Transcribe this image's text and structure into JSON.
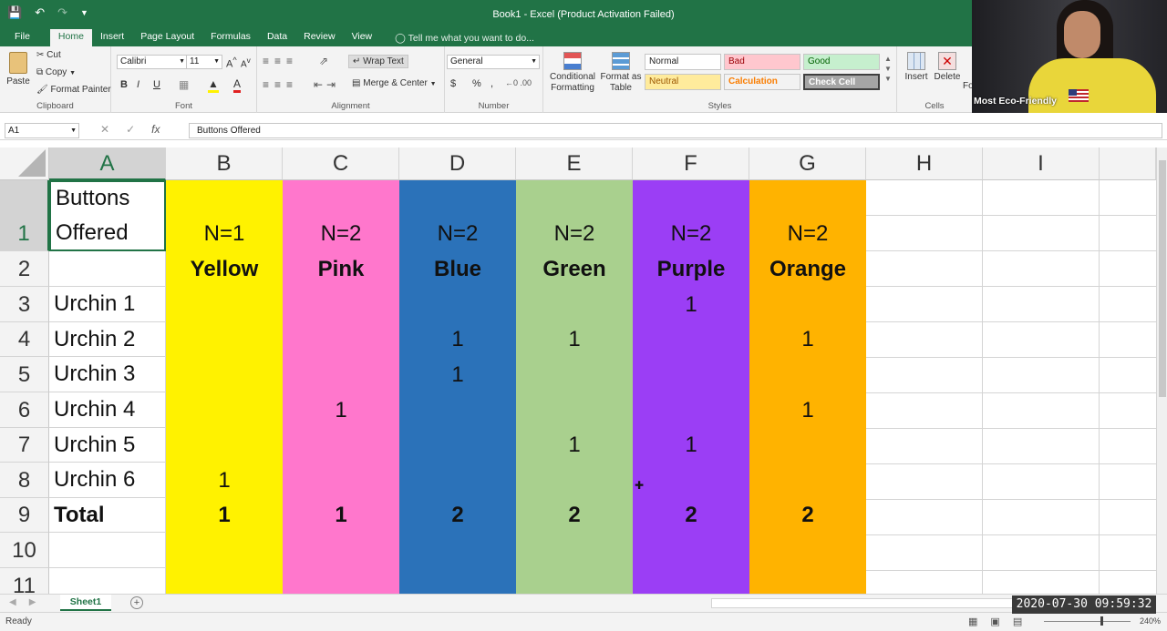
{
  "window": {
    "title": "Book1 - Excel (Product Activation Failed)"
  },
  "ribbon_tabs": [
    "File",
    "Home",
    "Insert",
    "Page Layout",
    "Formulas",
    "Data",
    "Review",
    "View"
  ],
  "tell_me": "Tell me what you want to do...",
  "clipboard": {
    "paste": "Paste",
    "cut": "Cut",
    "copy": "Copy",
    "format_painter": "Format Painter",
    "label": "Clipboard"
  },
  "font": {
    "name": "Calibri",
    "size": "11",
    "bold": "B",
    "italic": "I",
    "underline": "U",
    "label": "Font"
  },
  "alignment": {
    "wrap_text": "Wrap Text",
    "merge_center": "Merge & Center",
    "label": "Alignment"
  },
  "number": {
    "format": "General",
    "currency": "$",
    "percent": "%",
    "comma": ",",
    "label": "Number"
  },
  "styles": {
    "conditional": "Conditional Formatting",
    "format_table": "Format as Table",
    "normal": "Normal",
    "bad": "Bad",
    "good": "Good",
    "neutral": "Neutral",
    "calculation": "Calculation",
    "check_cell": "Check Cell",
    "label": "Styles"
  },
  "cells_group": {
    "insert": "Insert",
    "delete": "Delete",
    "format": "Fo",
    "label": "Cells"
  },
  "formula_bar": {
    "name_box": "A1",
    "fx": "fx",
    "content": "Buttons Offered"
  },
  "columns": [
    "A",
    "B",
    "C",
    "D",
    "E",
    "F",
    "G",
    "H",
    "I"
  ],
  "rows": [
    "1",
    "2",
    "3",
    "4",
    "5",
    "6",
    "7",
    "8",
    "9",
    "10",
    "11"
  ],
  "colors": {
    "yellow": "#fff200",
    "pink": "#ff77cc",
    "blue": "#2b72b9",
    "green": "#a9d08e",
    "purple": "#9b3ef5",
    "orange": "#ffb300",
    "excel_green": "#217346"
  },
  "grid": {
    "A1_line1": "Buttons",
    "A1_line2": "Offered",
    "header_n": [
      "N=1",
      "N=2",
      "N=2",
      "N=2",
      "N=2",
      "N=2"
    ],
    "header_color": [
      "Yellow",
      "Pink",
      "Blue",
      "Green",
      "Purple",
      "Orange"
    ],
    "row_labels": [
      "Urchin 1",
      "Urchin 2",
      "Urchin 3",
      "Urchin 4",
      "Urchin 5",
      "Urchin 6"
    ],
    "values": [
      [
        "",
        "",
        "",
        "",
        "1",
        ""
      ],
      [
        "",
        "",
        "1",
        "1",
        "",
        "1"
      ],
      [
        "",
        "",
        "1",
        "",
        "",
        ""
      ],
      [
        "",
        "1",
        "",
        "",
        "",
        "1"
      ],
      [
        "",
        "",
        "",
        "1",
        "1",
        ""
      ],
      [
        "1",
        "",
        "",
        "",
        "",
        ""
      ]
    ],
    "total_label": "Total",
    "totals": [
      "1",
      "1",
      "2",
      "2",
      "2",
      "2"
    ]
  },
  "sheet_tab": "Sheet1",
  "status": "Ready",
  "zoom": "240%",
  "timestamp": "2020-07-30  09:59:32",
  "webcam_label": "Most Eco-Friendly"
}
